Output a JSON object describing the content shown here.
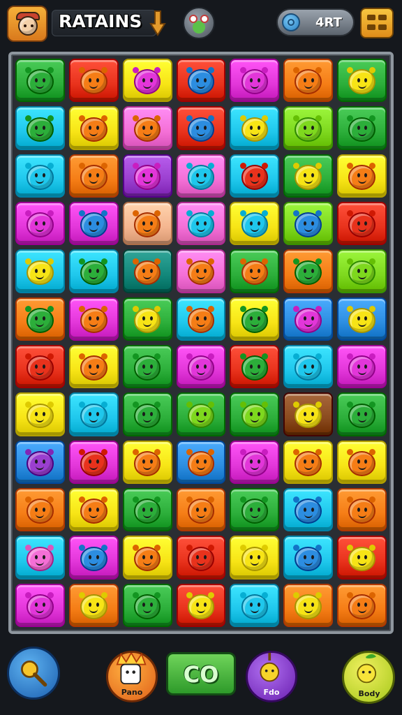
{
  "header": {
    "title": "RATAINS",
    "currency_value": "4RT",
    "avatar_icon": "chef-avatar-icon",
    "fairy_icon": "frog-fairy-icon",
    "coin_icon": "blue-gem-coin-icon",
    "menu_icon": "grid-menu-icon"
  },
  "board": {
    "rows": 12,
    "cols": 7,
    "palette": {
      "red": "#e8321c",
      "orange": "#f57d16",
      "yellow": "#f7e416",
      "lime": "#7ed81e",
      "green": "#2cae3a",
      "cyan": "#1fc7ec",
      "blue": "#2c8de0",
      "magenta": "#e236d9",
      "pink": "#f46fd6",
      "purple": "#9a3fcf",
      "peach": "#f4b58f",
      "teal": "#12877a",
      "brown": "#8a4a1e"
    },
    "grid": [
      [
        "green",
        "red",
        "yellow",
        "red",
        "magenta",
        "orange",
        "green"
      ],
      [
        "cyan",
        "yellow",
        "pink",
        "red",
        "cyan",
        "lime",
        "green"
      ],
      [
        "cyan",
        "orange",
        "purple",
        "pink",
        "cyan",
        "green",
        "yellow"
      ],
      [
        "magenta",
        "magenta",
        "peach",
        "pink",
        "yellow",
        "lime",
        "red"
      ],
      [
        "cyan",
        "cyan",
        "teal",
        "pink",
        "green",
        "orange",
        "lime"
      ],
      [
        "orange",
        "magenta",
        "green",
        "cyan",
        "yellow",
        "blue",
        "blue"
      ],
      [
        "red",
        "yellow",
        "green",
        "magenta",
        "red",
        "cyan",
        "magenta"
      ],
      [
        "yellow",
        "cyan",
        "green",
        "green",
        "green",
        "brown",
        "green"
      ],
      [
        "blue",
        "magenta",
        "yellow",
        "blue",
        "magenta",
        "yellow",
        "yellow"
      ],
      [
        "orange",
        "yellow",
        "green",
        "orange",
        "green",
        "cyan",
        "orange"
      ],
      [
        "cyan",
        "magenta",
        "yellow",
        "red",
        "yellow",
        "cyan",
        "red"
      ],
      [
        "magenta",
        "orange",
        "green",
        "red",
        "cyan",
        "orange",
        "orange"
      ]
    ],
    "faces": [
      [
        "green",
        "orange",
        "magenta",
        "blue",
        "magenta",
        "orange",
        "yellow"
      ],
      [
        "green",
        "orange",
        "orange",
        "blue",
        "yellow",
        "lime",
        "green"
      ],
      [
        "cyan",
        "orange",
        "magenta",
        "cyan",
        "red",
        "yellow",
        "orange"
      ],
      [
        "magenta",
        "blue",
        "orange",
        "cyan",
        "cyan",
        "blue",
        "red"
      ],
      [
        "yellow",
        "green",
        "orange",
        "orange",
        "orange",
        "green",
        "lime"
      ],
      [
        "green",
        "orange",
        "yellow",
        "orange",
        "green",
        "magenta",
        "yellow"
      ],
      [
        "red",
        "orange",
        "green",
        "magenta",
        "green",
        "cyan",
        "magenta"
      ],
      [
        "yellow",
        "cyan",
        "green",
        "lime",
        "lime",
        "yellow",
        "green"
      ],
      [
        "purple",
        "red",
        "orange",
        "orange",
        "magenta",
        "orange",
        "orange"
      ],
      [
        "orange",
        "orange",
        "green",
        "orange",
        "green",
        "blue",
        "orange"
      ],
      [
        "pink",
        "blue",
        "orange",
        "red",
        "yellow",
        "blue",
        "yellow"
      ],
      [
        "magenta",
        "yellow",
        "green",
        "yellow",
        "cyan",
        "yellow",
        "orange"
      ]
    ]
  },
  "footer": {
    "search_icon": "magnifier-booster-icon",
    "left_booster_label": "Pano",
    "go_label": "CO",
    "mid_booster_label": "Fdo",
    "right_booster_label": "Body"
  }
}
